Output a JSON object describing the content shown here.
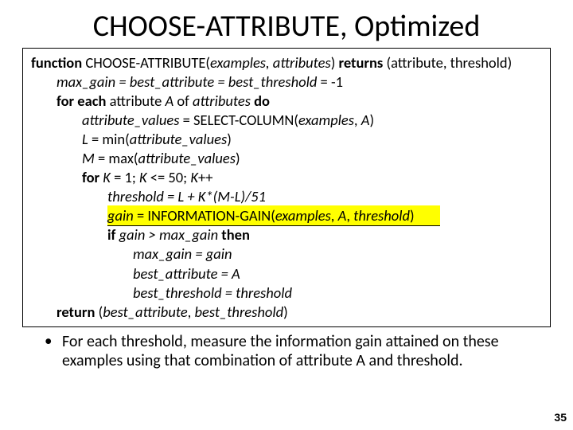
{
  "title": "CHOOSE-ATTRIBUTE, Optimized",
  "code": {
    "fn_kw": "function ",
    "fn_name": "CHOOSE-ATTRIBUTE(",
    "fn_args": "examples, attributes",
    "fn_close": ") ",
    "returns_kw": "returns ",
    "returns_val": "(attribute, threshold)",
    "init_lhs": "max_gain = best_attribute = best_threshold",
    "init_rhs": " = -1",
    "foreach_a": "for each ",
    "foreach_b": "attribute ",
    "foreach_c": "A ",
    "foreach_d": "of ",
    "foreach_e": "attributes ",
    "foreach_f": "do",
    "av_lhs": "attribute_values",
    "av_rhs": " = SELECT-COLUMN(",
    "av_arg1": "examples",
    "av_sep": ", ",
    "av_arg2": "A",
    "av_close": ")",
    "L_lhs": "L",
    "L_rhs": " = min(",
    "L_arg": "attribute_values",
    "L_close": ")",
    "M_lhs": "M",
    "M_rhs": " = max(",
    "M_arg": "attribute_values",
    "M_close": ")",
    "fork_a": "for ",
    "fork_b": "K",
    "fork_c": " = 1; ",
    "fork_d": "K",
    "fork_e": " <= 50; ",
    "fork_f": "K",
    "fork_g": "++",
    "thr_a": "threshold = L + K*(M-L)/51",
    "gain_a": "gain",
    "gain_b": " = INFORMATION-GAIN(",
    "gain_c": "examples",
    "gain_d": ", ",
    "gain_e": "A",
    "gain_f": ", ",
    "gain_g": "threshold",
    "gain_h": ")",
    "if_a": "if ",
    "if_b": "gain > max_gain ",
    "if_c": "then",
    "set1": "max_gain = gain",
    "set2": "best_attribute = A",
    "set3": "best_threshold = threshold",
    "ret_kw": "return ",
    "ret_a": "(",
    "ret_b": "best_attribute",
    "ret_c": ", ",
    "ret_d": "best_threshold",
    "ret_e": ")"
  },
  "bullet": "For each threshold, measure the information gain attained on these examples using that combination of attribute A and threshold.",
  "page_number": "35"
}
